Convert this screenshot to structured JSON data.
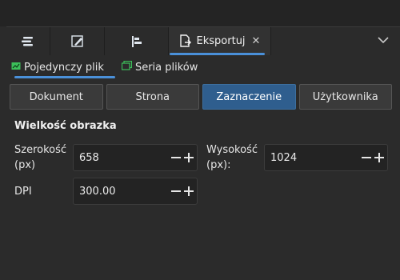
{
  "tabs": [
    {
      "icon": "layers-icon"
    },
    {
      "icon": "pen-icon"
    },
    {
      "icon": "align-icon"
    },
    {
      "icon": "export-icon",
      "label": "Eksportuj",
      "close": "✕",
      "active": true
    }
  ],
  "subtabs": [
    {
      "label": "Pojedynczy plik",
      "icon": "single-file-icon",
      "active": true
    },
    {
      "label": "Seria plików",
      "icon": "batch-files-icon"
    }
  ],
  "segments": [
    {
      "label": "Dokument"
    },
    {
      "label": "Strona"
    },
    {
      "label": "Zaznaczenie",
      "selected": true
    },
    {
      "label": "Użytkownika"
    }
  ],
  "image_size": {
    "title": "Wielkość obrazka",
    "width_label": "Szerokość\n(px)",
    "width_value": "658",
    "height_label": "Wysokość\n(px):",
    "height_value": "1024",
    "dpi_label": "DPI",
    "dpi_value": "300.00"
  },
  "colors": {
    "accent": "#4a90d9",
    "selected_segment": "#2f5e8e",
    "icon_green": "#3cbf5a"
  }
}
